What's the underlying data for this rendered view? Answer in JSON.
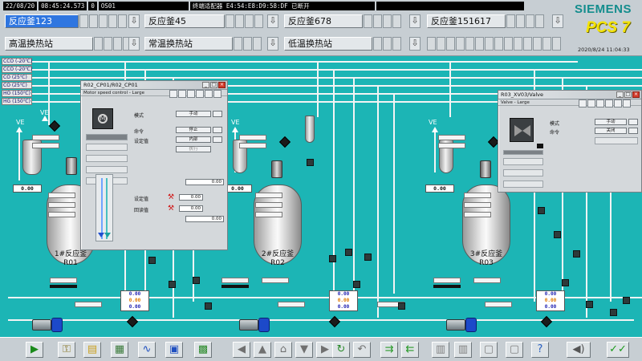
{
  "status": {
    "date": "22/08/20",
    "time": "08:45:24.573",
    "counter": "0",
    "station": "OS01",
    "alarm_text": "终端适配器 E4:54:E8:D9:58:DF 已断开"
  },
  "nav": {
    "row1": [
      "反应釜123",
      "反应釜45",
      "反应釜678",
      "反应釜151617"
    ],
    "row2": [
      "高温换热站",
      "常温换热站",
      "低温换热站"
    ],
    "down_glyph": "⇩"
  },
  "brand": {
    "line1": "SIEMENS",
    "line2": "PCS 7"
  },
  "clock": "2020/8/24 11:04:33",
  "media": [
    "CCO (-20℃)",
    "CCO (-20℃)",
    "CO (25℃)",
    "CO (25℃)",
    "HO (150℃)",
    "HG (150℃)"
  ],
  "reactors": [
    {
      "name_cn": "1#反应釜",
      "tag": "R01"
    },
    {
      "name_cn": "2#反应釜",
      "tag": "R02"
    },
    {
      "name_cn": "3#反应釜",
      "tag": "R03"
    }
  ],
  "ve_label": "VE",
  "value_zero": "0.00",
  "popup_motor": {
    "title": "R02_CP01/R02_CP01",
    "subtitle": "Motor speed control - Large",
    "mode_label": "模式",
    "mode_value": "手动",
    "cmd_label": "命令",
    "cmd_value": "停止",
    "setpoint_label": "设定值",
    "setpoint_value": "内部",
    "setpoint_btn": "执行",
    "value1": "0.00",
    "sp_label": "设定值",
    "sp_value": "0.00",
    "rb_label": "回读值",
    "rb_value": "0.00",
    "value2": "0.00"
  },
  "popup_valve": {
    "title": "R03_XV03/Valve",
    "subtitle": "Valve - Large",
    "mode_label": "模式",
    "mode_value": "手动",
    "cmd_label": "命令",
    "cmd_value": "关闭"
  },
  "colors": {
    "process_bg": "#1cb5b5",
    "active_tab": "#2f76e0",
    "pump_head": "#1c49c9"
  },
  "toolbar_icons": [
    "play-icon",
    "key-icon",
    "folder-icon",
    "document-icon",
    "trend-icon",
    "print-icon",
    "export-icon",
    "arrow-left-icon",
    "arrow-up-icon",
    "home-icon",
    "arrow-down-icon",
    "arrow-right-icon",
    "refresh-icon",
    "back-icon",
    "layer-icon",
    "layer2-icon",
    "save-icon",
    "save2-icon",
    "window-icon",
    "window2-icon",
    "help-icon",
    "speaker-icon",
    "acknowledge-icon"
  ]
}
